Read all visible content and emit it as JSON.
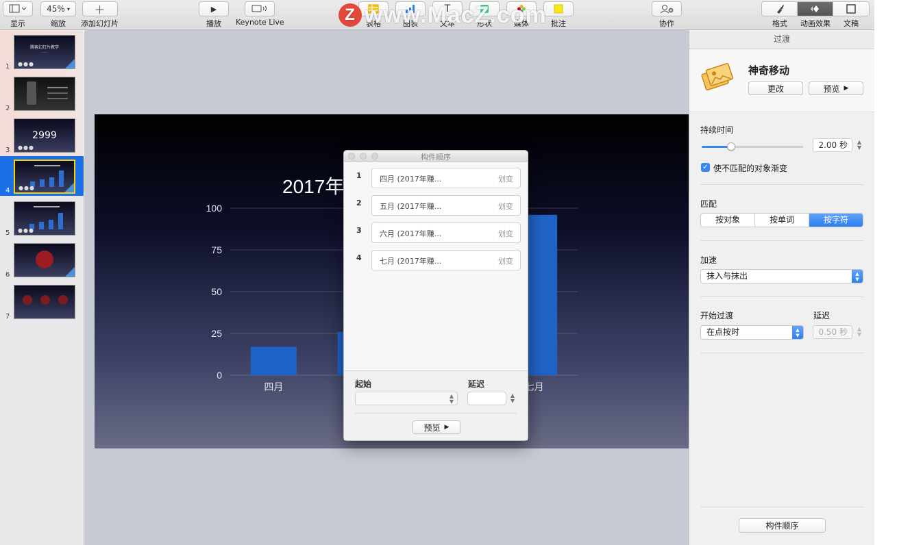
{
  "toolbar": {
    "view_label": "显示",
    "zoom_value": "45%",
    "zoom_label": "缩放",
    "add_slide_label": "添加幻灯片",
    "play_label": "播放",
    "keynote_live_label": "Keynote Live",
    "watermark_text": "www.MacZ.com",
    "watermark_logo": "Z",
    "insert": [
      "表格",
      "图表",
      "文本",
      "形状",
      "媒体",
      "批注"
    ],
    "collaborate_label": "协作",
    "right_tabs": [
      {
        "label": "格式",
        "icon": "paintbrush-icon"
      },
      {
        "label": "动画效果",
        "icon": "diamond-icon",
        "active": true
      },
      {
        "label": "文稿",
        "icon": "document-icon"
      }
    ]
  },
  "navigator": {
    "slides": [
      {
        "num": "1",
        "title": "腾客幻灯片教学",
        "subtitle": "······"
      },
      {
        "num": "2"
      },
      {
        "num": "3",
        "big": "2999"
      },
      {
        "num": "4",
        "selected": true
      },
      {
        "num": "5"
      },
      {
        "num": "6"
      },
      {
        "num": "7"
      }
    ]
  },
  "slide": {
    "title": "2017年"
  },
  "chart_data": {
    "type": "bar",
    "categories": [
      "四月",
      "五月",
      "六月",
      "七月"
    ],
    "visible_categories": [
      "四月",
      "七月"
    ],
    "values": [
      17,
      26,
      null,
      96
    ],
    "yticks": [
      "0",
      "25",
      "50",
      "75",
      "100"
    ],
    "ylim": [
      0,
      100
    ],
    "grid": true,
    "bar_color": "#1f63c7"
  },
  "dialog": {
    "title": "构件顺序",
    "builds": [
      {
        "num": "1",
        "name": "四月 (2017年赚...",
        "effect": "划变"
      },
      {
        "num": "2",
        "name": "五月 (2017年赚...",
        "effect": "划变"
      },
      {
        "num": "3",
        "name": "六月 (2017年赚...",
        "effect": "划变"
      },
      {
        "num": "4",
        "name": "七月 (2017年赚...",
        "effect": "划变"
      }
    ],
    "start_label": "起始",
    "delay_label": "延迟",
    "preview_label": "预览"
  },
  "inspector": {
    "tab": "过渡",
    "effect_name": "神奇移动",
    "change_label": "更改",
    "preview_label": "预览",
    "duration_label": "持续时间",
    "duration_value": "2.00 秒",
    "duration_fraction": 0.29,
    "fade_label": "使不匹配的对象渐变",
    "match_label": "匹配",
    "match_options": [
      "按对象",
      "按单词",
      "按字符"
    ],
    "match_selected": 2,
    "accel_label": "加速",
    "accel_value": "抹入与抹出",
    "start_label": "开始过渡",
    "start_value": "在点按时",
    "delay_label": "延迟",
    "delay_value": "0.50 秒",
    "build_order_label": "构件顺序"
  }
}
